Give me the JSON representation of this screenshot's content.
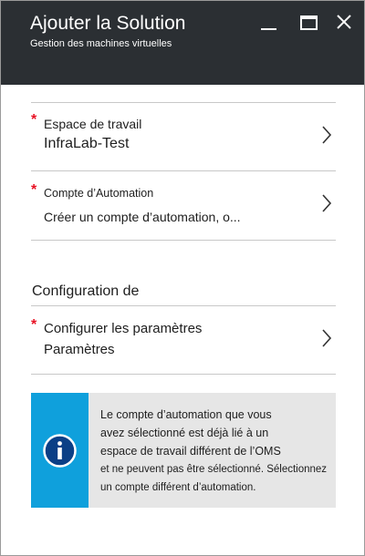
{
  "header": {
    "title": "Ajouter la Solution",
    "subtitle": "Gestion des machines virtuelles"
  },
  "fields": {
    "workspace": {
      "required_mark": "*",
      "label": "Espace de travail",
      "value": "InfraLab-Test"
    },
    "automation": {
      "required_mark": "*",
      "label": "Compte d’Automation",
      "value": "Créer un compte d’automation, o..."
    }
  },
  "section": {
    "title": "Configuration de",
    "params": {
      "required_mark": "*",
      "label": "Configurer les paramètres",
      "value": "Paramètres"
    }
  },
  "info": {
    "icon": "info-icon",
    "lines": [
      "Le compte d’automation que vous",
      "avez sélectionné est déjà lié à un",
      "espace de travail différent de l’OMS",
      "et ne peuvent pas être sélectionné. Sélectionnez",
      "un compte différent d’automation."
    ]
  },
  "colors": {
    "header_bg": "#2b2f33",
    "required": "#e81123",
    "info_accent": "#0fa0dc",
    "info_bg": "#e6e6e6"
  }
}
